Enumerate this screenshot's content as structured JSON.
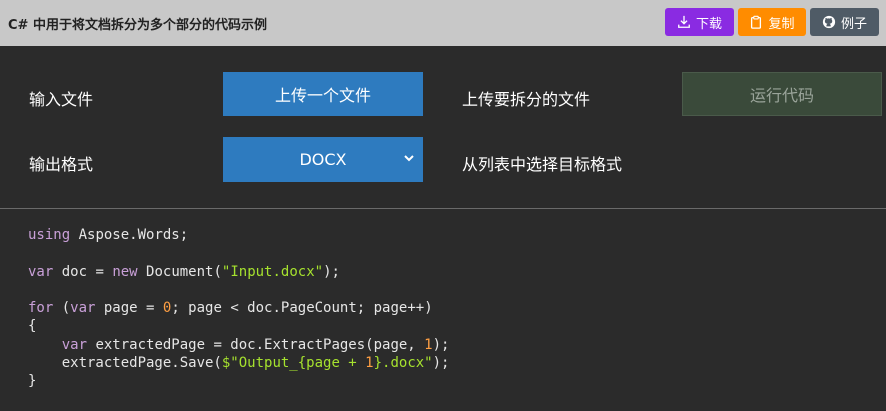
{
  "header": {
    "title": "C# 中用于将文档拆分为多个部分的代码示例",
    "download_label": "下载",
    "copy_label": "复制",
    "example_label": "例子"
  },
  "form": {
    "input_label": "输入文件",
    "upload_label": "上传一个文件",
    "upload_hint": "上传要拆分的文件",
    "run_label": "运行代码",
    "output_label": "输出格式",
    "format_value": "DOCX",
    "format_hint": "从列表中选择目标格式"
  },
  "code": {
    "l1_kw": "using",
    "l1_rest": " Aspose.Words;",
    "l3_kw": "var",
    "l3_a": " doc = ",
    "l3_kw2": "new",
    "l3_b": " Document(",
    "l3_str": "\"Input.docx\"",
    "l3_c": ");",
    "l5_kw": "for",
    "l5_a": " (",
    "l5_kw2": "var",
    "l5_b": " page = ",
    "l5_num": "0",
    "l5_c": "; page < doc.PageCount; page++)",
    "l6": "{",
    "l7_kw": "var",
    "l7_a": " extractedPage = doc.ExtractPages(page, ",
    "l7_num": "1",
    "l7_b": ");",
    "l8_a": "extractedPage.Save(",
    "l8_str1": "$\"Output_{page + ",
    "l8_num": "1",
    "l8_str2": "}.docx\"",
    "l8_b": ");",
    "l9": "}"
  },
  "colors": {
    "header_bg": "#c8c8c8",
    "download": "#8a2be2",
    "copy": "#ff8c00",
    "example": "#4f5b66",
    "accent": "#2e7bbf",
    "body_bg": "#2b2b2b"
  },
  "icons": {
    "download": "download-icon",
    "copy": "clipboard-icon",
    "example": "github-icon",
    "select": "chevron-down-icon"
  }
}
